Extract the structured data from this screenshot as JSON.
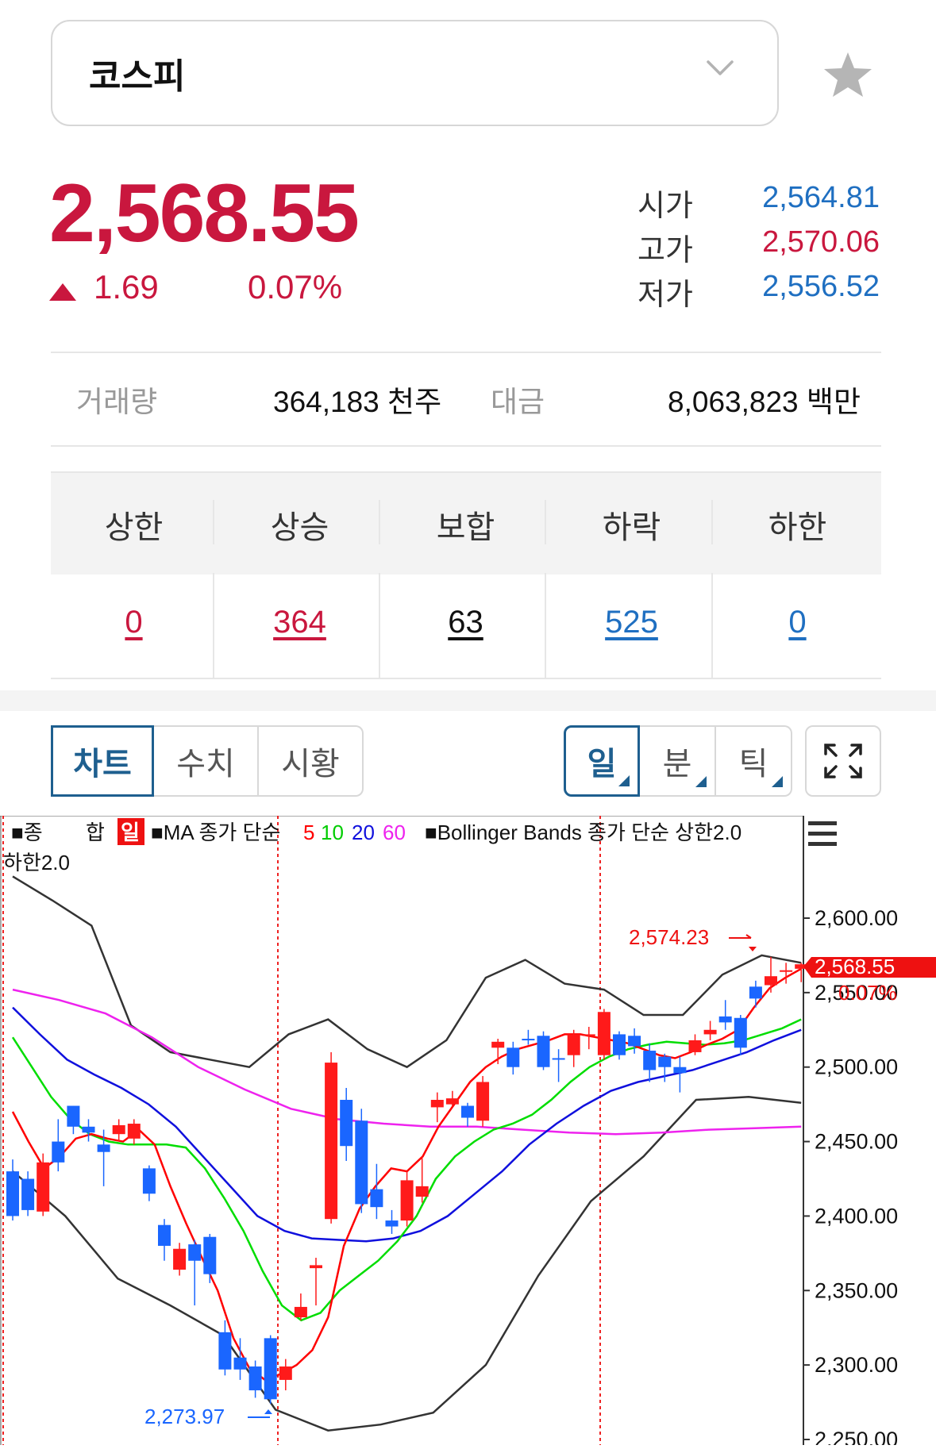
{
  "header": {
    "index_name": "코스피",
    "dropdown_icon": "chevron-down-icon",
    "favorite_icon": "star-icon"
  },
  "quote": {
    "price": "2,568.55",
    "change": "1.69",
    "change_pct": "0.07%",
    "direction_icon": "up-triangle-icon",
    "ohl": [
      {
        "label": "시가",
        "value": "2,564.81",
        "color": "#1f6fc1"
      },
      {
        "label": "고가",
        "value": "2,570.06",
        "color": "#c9173e"
      },
      {
        "label": "저가",
        "value": "2,556.52",
        "color": "#1f6fc1"
      }
    ]
  },
  "volume": {
    "vol_label": "거래량",
    "vol_value": "364,183 천주",
    "amt_label": "대금",
    "amt_value": "8,063,823 백만"
  },
  "breadth": [
    {
      "label": "상한",
      "value": "0",
      "color": "#c9173e"
    },
    {
      "label": "상승",
      "value": "364",
      "color": "#c9173e"
    },
    {
      "label": "보합",
      "value": "63",
      "color": "#111111"
    },
    {
      "label": "하락",
      "value": "525",
      "color": "#1f6fc1"
    },
    {
      "label": "하한",
      "value": "0",
      "color": "#1f6fc1"
    }
  ],
  "tabs": {
    "view": [
      "차트",
      "수치",
      "시황"
    ],
    "period": [
      "일",
      "분",
      "틱"
    ],
    "fullscreen_icon": "expand-icon"
  },
  "chart": {
    "legend_prefix": "■종",
    "legend_hap": "합",
    "legend_period": "일",
    "ma_label": "■MA 종가 단순",
    "ma_periods": [
      "5",
      "10",
      "20",
      "60"
    ],
    "bb_label": "■Bollinger Bands 종가 단순 상한2.0",
    "bb_lower": "하한2.0",
    "menu_icon": "hamburger-menu-icon",
    "last_price_tag": "2,568.55",
    "last_pct_tag": "0.07%",
    "high_marker": "2,574.23",
    "low_marker": "2,273.97",
    "colors": {
      "up": "#ff1a1a",
      "down": "#1a66ff",
      "ma5": "#ff0000",
      "ma10": "#00dd00",
      "ma20": "#1010dd",
      "ma60": "#ee22ee",
      "bb": "#333333"
    }
  },
  "chart_data": {
    "type": "candlestick",
    "y_ticks": [
      "2,600.00",
      "2,550.00",
      "2,500.00",
      "2,450.00",
      "2,400.00",
      "2,350.00",
      "2,300.00",
      "2,250.00"
    ],
    "ylim": [
      2250,
      2610
    ],
    "candles": [
      [
        2430,
        2400,
        2438,
        2397
      ],
      [
        2425,
        2404,
        2430,
        2400
      ],
      [
        2403,
        2436,
        2442,
        2400
      ],
      [
        2450,
        2436,
        2465,
        2430
      ],
      [
        2474,
        2460,
        2474,
        2455
      ],
      [
        2460,
        2456,
        2465,
        2450
      ],
      [
        2448,
        2443,
        2458,
        2420
      ],
      [
        2455,
        2461,
        2465,
        2450
      ],
      [
        2452,
        2462,
        2465,
        2448
      ],
      [
        2432,
        2415,
        2434,
        2410
      ],
      [
        2394,
        2380,
        2398,
        2370
      ],
      [
        2364,
        2378,
        2382,
        2360
      ],
      [
        2381,
        2370,
        2384,
        2340
      ],
      [
        2386,
        2361,
        2388,
        2355
      ],
      [
        2322,
        2297,
        2330,
        2293
      ],
      [
        2305,
        2297,
        2318,
        2290
      ],
      [
        2299,
        2283,
        2303,
        2278
      ],
      [
        2318,
        2277,
        2320,
        2274
      ],
      [
        2290,
        2299,
        2304,
        2283
      ],
      [
        2332,
        2339,
        2348,
        2330
      ],
      [
        2365,
        2367,
        2372,
        2340
      ],
      [
        2398,
        2503,
        2510,
        2395
      ],
      [
        2478,
        2447,
        2486,
        2437
      ],
      [
        2464,
        2408,
        2472,
        2402
      ],
      [
        2418,
        2406,
        2435,
        2398
      ],
      [
        2397,
        2393,
        2404,
        2388
      ],
      [
        2397,
        2424,
        2430,
        2393
      ],
      [
        2413,
        2420,
        2440,
        2409
      ],
      [
        2473,
        2478,
        2483,
        2463
      ],
      [
        2475,
        2479,
        2484,
        2474
      ],
      [
        2474,
        2466,
        2476,
        2460
      ],
      [
        2464,
        2490,
        2494,
        2460
      ],
      [
        2513,
        2517,
        2519,
        2502
      ],
      [
        2513,
        2500,
        2517,
        2495
      ],
      [
        2519,
        2518,
        2525,
        2515
      ],
      [
        2521,
        2500,
        2524,
        2498
      ],
      [
        2506,
        2505,
        2512,
        2490
      ],
      [
        2508,
        2522,
        2525,
        2500
      ],
      [
        2522,
        2522,
        2527,
        2512
      ],
      [
        2508,
        2537,
        2539,
        2505
      ],
      [
        2522,
        2508,
        2524,
        2505
      ],
      [
        2521,
        2514,
        2526,
        2509
      ],
      [
        2511,
        2498,
        2516,
        2490
      ],
      [
        2507,
        2500,
        2509,
        2490
      ],
      [
        2500,
        2496,
        2507,
        2483
      ],
      [
        2510,
        2518,
        2522,
        2508
      ],
      [
        2522,
        2525,
        2531,
        2518
      ],
      [
        2534,
        2530,
        2545,
        2525
      ],
      [
        2533,
        2513,
        2535,
        2508
      ],
      [
        2554,
        2546,
        2558,
        2540
      ],
      [
        2555,
        2561,
        2574,
        2550
      ],
      [
        2564,
        2565,
        2570,
        2556
      ],
      [
        2566,
        2569,
        2570,
        2557
      ]
    ],
    "ma5": [
      2470,
      2450,
      2432,
      2440,
      2452,
      2455,
      2452,
      2450,
      2458,
      2448,
      2420,
      2395,
      2372,
      2350,
      2318,
      2298,
      2290,
      2294,
      2300,
      2310,
      2332,
      2380,
      2405,
      2420,
      2432,
      2430,
      2440,
      2460,
      2475,
      2490,
      2500,
      2507,
      2512,
      2515,
      2518,
      2522,
      2522,
      2520,
      2518,
      2516,
      2512,
      2508,
      2506,
      2510,
      2515,
      2519,
      2525,
      2540,
      2553,
      2560,
      2566
    ],
    "ma10": [
      2520,
      2500,
      2480,
      2465,
      2455,
      2450,
      2448,
      2448,
      2448,
      2446,
      2432,
      2412,
      2390,
      2363,
      2340,
      2330,
      2335,
      2350,
      2360,
      2370,
      2383,
      2400,
      2425,
      2440,
      2450,
      2458,
      2462,
      2468,
      2478,
      2490,
      2500,
      2507,
      2512,
      2515,
      2517,
      2516,
      2515,
      2516,
      2518,
      2522,
      2526,
      2532
    ],
    "ma20": [
      2540,
      2522,
      2505,
      2495,
      2486,
      2475,
      2460,
      2440,
      2420,
      2400,
      2390,
      2385,
      2384,
      2383,
      2385,
      2390,
      2400,
      2415,
      2430,
      2448,
      2462,
      2474,
      2484,
      2490,
      2494,
      2498,
      2504,
      2510,
      2518,
      2525
    ],
    "ma60": [
      2552,
      2545,
      2536,
      2520,
      2500,
      2485,
      2472,
      2465,
      2462,
      2460,
      2460,
      2458,
      2456,
      2455,
      2456,
      2458,
      2459,
      2460
    ],
    "bb_upper": [
      2628,
      2612,
      2595,
      2528,
      2510,
      2505,
      2500,
      2522,
      2532,
      2512,
      2500,
      2518,
      2560,
      2572,
      2556,
      2552,
      2535,
      2535,
      2562,
      2575,
      2570
    ],
    "bb_lower": [
      2430,
      2400,
      2358,
      2340,
      2320,
      2270,
      2256,
      2260,
      2268,
      2300,
      2360,
      2410,
      2440,
      2478,
      2480,
      2476
    ]
  }
}
